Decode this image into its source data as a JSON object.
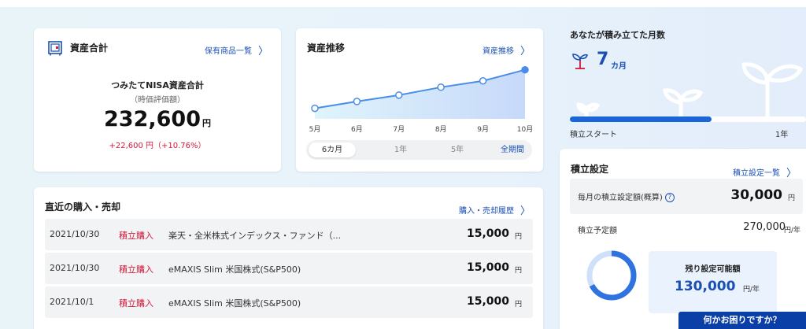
{
  "asset": {
    "title": "資産合計",
    "link": "保有商品一覧",
    "subtitle": "つみたてNISA資産合計",
    "note": "（時価評価額）",
    "amount": "232,600",
    "yen": "円",
    "gain": "+22,600 円（+10.76%）"
  },
  "trend": {
    "title": "資産推移",
    "link": "資産推移",
    "months": [
      "5月",
      "6月",
      "7月",
      "8月",
      "9月",
      "10月"
    ],
    "tabs": [
      {
        "label": "6カ月",
        "active": true
      },
      {
        "label": "1年",
        "active": false
      },
      {
        "label": "5年",
        "active": false
      },
      {
        "label": "全期間",
        "active": false
      }
    ]
  },
  "chart_data": {
    "type": "area",
    "categories": [
      "5月",
      "6月",
      "7月",
      "8月",
      "9月",
      "10月"
    ],
    "values": [
      0.2,
      0.33,
      0.45,
      0.6,
      0.72,
      0.93
    ],
    "title": "資産推移",
    "xlabel": "",
    "ylabel": "",
    "grid": false,
    "colors": {
      "line": "#4a8de8",
      "fill_top": "#c9dcfb",
      "fill_bottom": "#dff2fb"
    }
  },
  "recent": {
    "title": "直近の購入・売却",
    "link": "購入・売却履歴",
    "rows": [
      {
        "date": "2021/10/30",
        "type": "積立購入",
        "fund": "楽天・全米株式インデックス・ファンド（...",
        "amount": "15,000",
        "yen": "円"
      },
      {
        "date": "2021/10/30",
        "type": "積立購入",
        "fund": "eMAXIS Slim 米国株式(S&P500)",
        "amount": "15,000",
        "yen": "円"
      },
      {
        "date": "2021/10/1",
        "type": "積立購入",
        "fund": "eMAXIS Slim 米国株式(S&P500)",
        "amount": "15,000",
        "yen": "円"
      }
    ]
  },
  "months_panel": {
    "title": "あなたが積み立てた月数",
    "value": "7",
    "unit": "カ月",
    "progress": 0.6,
    "start_label": "積立スタート",
    "end_label": "1年"
  },
  "settings": {
    "title": "積立設定",
    "link": "積立設定一覧",
    "monthly_label": "毎月の積立設定額(概算)",
    "monthly_value": "30,000",
    "monthly_yen": "円",
    "plan_label": "積立予定額",
    "plan_value": "270,000",
    "plan_unit": "円/年",
    "remain_label": "残り設定可能額",
    "remain_value": "130,000",
    "remain_unit": "円/年",
    "donut_used_fraction": 0.675
  },
  "help_button": "何かお困りですか？",
  "colors": {
    "brand_blue": "#1a4fb4",
    "red": "#d31a3b",
    "progress": "#1a66d9"
  }
}
